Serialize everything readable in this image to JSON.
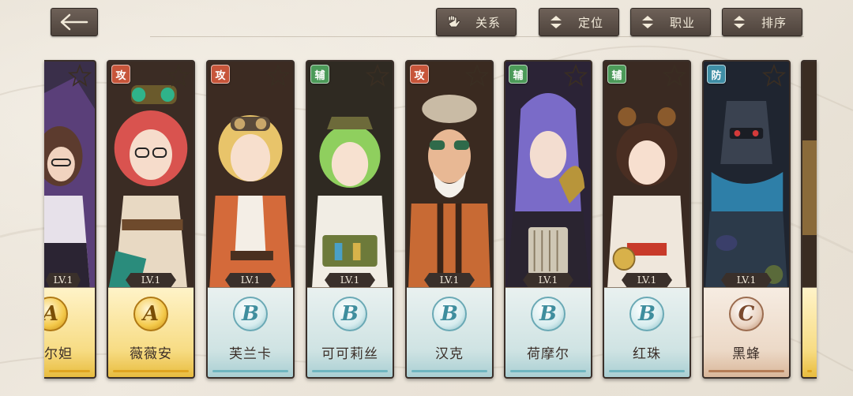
{
  "header": {
    "buttons": [
      {
        "label": "关系",
        "icon": "glove-icon"
      },
      {
        "label": "定位",
        "icon": "sort-arrows-icon"
      },
      {
        "label": "职业",
        "icon": "sort-arrows-icon"
      },
      {
        "label": "排序",
        "icon": "sort-arrows-icon"
      }
    ]
  },
  "cards": [
    {
      "name": "尔妲",
      "level": "LV.1",
      "rank": "A",
      "role": ""
    },
    {
      "name": "薇薇安",
      "level": "LV.1",
      "rank": "A",
      "role": "攻"
    },
    {
      "name": "芙兰卡",
      "level": "LV.1",
      "rank": "B",
      "role": "攻"
    },
    {
      "name": "可可莉丝",
      "level": "LV.1",
      "rank": "B",
      "role": "辅"
    },
    {
      "name": "汉克",
      "level": "LV.1",
      "rank": "B",
      "role": "攻"
    },
    {
      "name": "荷摩尔",
      "level": "LV.1",
      "rank": "B",
      "role": "辅"
    },
    {
      "name": "红珠",
      "level": "LV.1",
      "rank": "B",
      "role": "辅"
    },
    {
      "name": "黑蜂",
      "level": "LV.1",
      "rank": "C",
      "role": "防"
    }
  ],
  "colors": {
    "frame": "#3b302a",
    "attack_tag": "#c7553a",
    "support_tag": "#4c9a59",
    "defense_tag": "#3f8ea5",
    "rank_a": "#f4c94a",
    "rank_b": "#d6ecee",
    "rank_c": "#e9d2c0"
  }
}
